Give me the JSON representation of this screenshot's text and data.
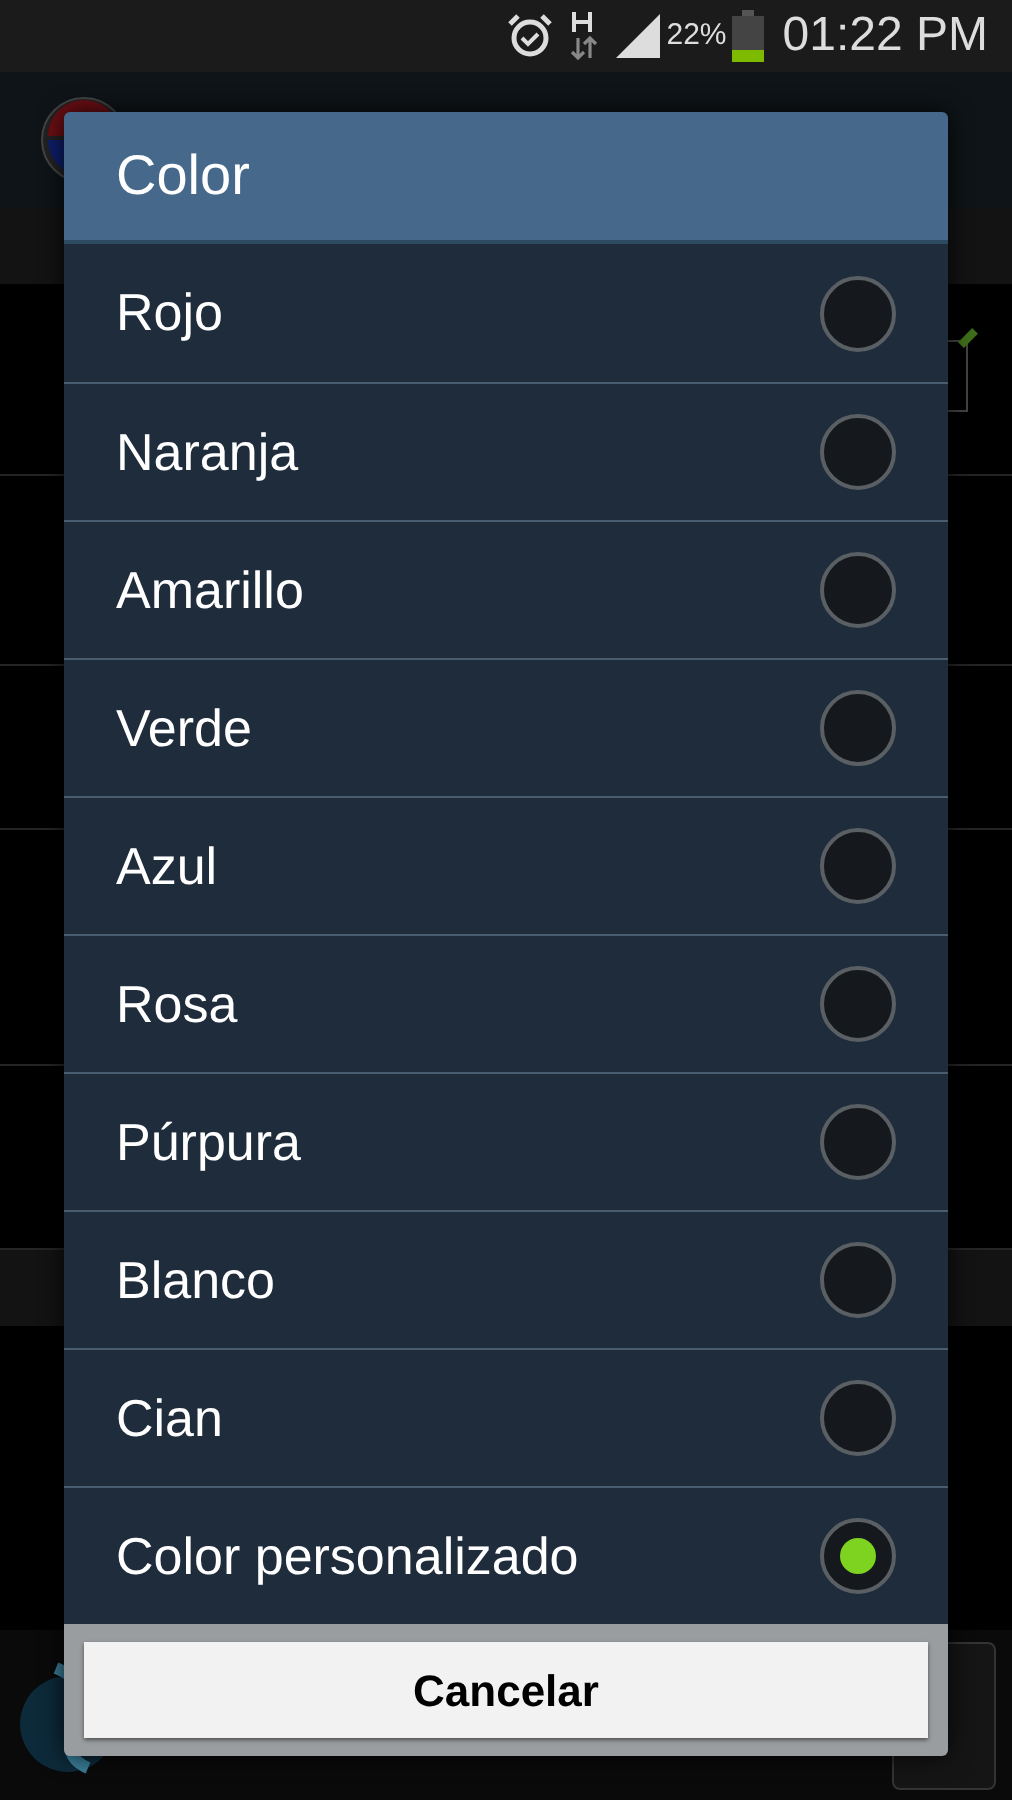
{
  "status_bar": {
    "battery": "22%",
    "time": "01:22 PM"
  },
  "background": {
    "rows": [
      {
        "checkbox": true
      },
      {},
      {},
      {},
      {}
    ]
  },
  "dialog": {
    "title": "Color",
    "options": [
      {
        "label": "Rojo",
        "selected": false
      },
      {
        "label": "Naranja",
        "selected": false
      },
      {
        "label": "Amarillo",
        "selected": false
      },
      {
        "label": "Verde",
        "selected": false
      },
      {
        "label": "Azul",
        "selected": false
      },
      {
        "label": "Rosa",
        "selected": false
      },
      {
        "label": "Púrpura",
        "selected": false
      },
      {
        "label": "Blanco",
        "selected": false
      },
      {
        "label": "Cian",
        "selected": false
      },
      {
        "label": "Color personalizado",
        "selected": true
      }
    ],
    "button": "Cancelar"
  }
}
